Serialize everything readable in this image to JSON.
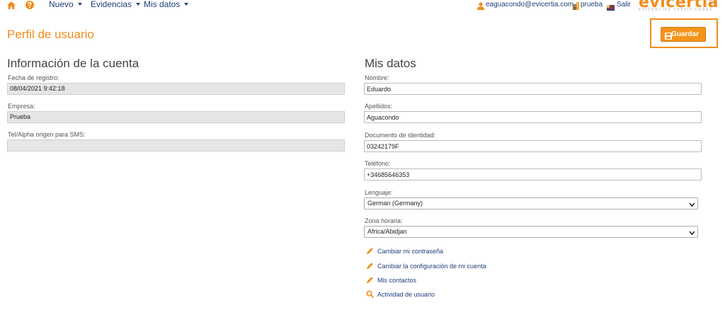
{
  "topbar": {
    "home_icon": "home-icon",
    "help_icon": "question-circle-icon",
    "menu": [
      {
        "label": "Nuevo"
      },
      {
        "label": "Evidencias"
      },
      {
        "label": "Mis datos"
      }
    ],
    "user_email": "eaguacondo@evicertia.com",
    "company": "prueba",
    "logout": "Salir",
    "logo_text": "evicertia",
    "logo_tagline": "EVIDENCIAS CERTIFICADAS"
  },
  "page": {
    "title": "Perfil de usuario",
    "save_label": "Guardar"
  },
  "account": {
    "heading": "Información de la cuenta",
    "registration_label": "Fecha de registro:",
    "registration_value": "08/04/2021 9:42:18",
    "company_label": "Empresa:",
    "company_value": "Prueba",
    "sms_label": "Tel/Alpha origen para SMS:",
    "sms_value": ""
  },
  "profile": {
    "heading": "Mis datos",
    "name_label": "Nombre:",
    "name_value": "Eduardo",
    "surname_label": "Apellidos:",
    "surname_value": "Aguacondo",
    "id_label": "Documento de identidad:",
    "id_value": "03242179F",
    "phone_label": "Teléfono:",
    "phone_value": "+34685646353",
    "language_label": "Lenguaje:",
    "language_value": "German (Germany)",
    "timezone_label": "Zona horaria:",
    "timezone_value": "Africa/Abidjan"
  },
  "links": [
    {
      "label": "Cambiar mi contraseña",
      "icon": "pencil-icon"
    },
    {
      "label": "Cambiar la configuración de mi cuenta",
      "icon": "pencil-icon"
    },
    {
      "label": "Mis contactos",
      "icon": "pencil-icon"
    },
    {
      "label": "Actividad de usuario",
      "icon": "search-icon"
    }
  ],
  "colors": {
    "accent": "#f28c1c",
    "link": "#1f3f7a",
    "readonly_bg": "#e6e6e6"
  }
}
